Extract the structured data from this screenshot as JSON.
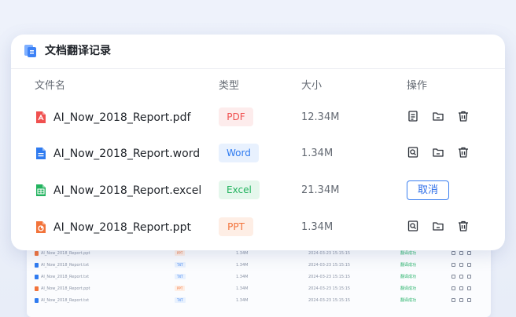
{
  "header": {
    "title": "文档翻译记录",
    "icon": "document-translate-icon"
  },
  "columns": {
    "name": "文件名",
    "type": "类型",
    "size": "大小",
    "actions": "操作"
  },
  "rows": [
    {
      "name": "AI_Now_2018_Report.pdf",
      "type": "PDF",
      "size": "12.34M",
      "icon": "pdf-icon",
      "color": "#f0504f",
      "bg": "#fdecec",
      "mode": "done-doc"
    },
    {
      "name": "AI_Now_2018_Report.word",
      "type": "Word",
      "size": "1.34M",
      "icon": "word-icon",
      "color": "#2f7bf0",
      "bg": "#e8f1fe",
      "mode": "done-preview"
    },
    {
      "name": "AI_Now_2018_Report.excel",
      "type": "Excel",
      "size": "21.34M",
      "icon": "excel-icon",
      "color": "#22b35e",
      "bg": "#e5f7ec",
      "mode": "cancel"
    },
    {
      "name": "AI_Now_2018_Report.ppt",
      "type": "PPT",
      "size": "1.34M",
      "icon": "ppt-icon",
      "color": "#f2733a",
      "bg": "#feeee5",
      "mode": "done-preview"
    }
  ],
  "cancel_label": "取消",
  "background_rows": [
    {
      "name": "AI_Now_2018_Report.ppt",
      "type": "PPT",
      "size": "1.34M",
      "time": "2024-03-23 15:15:15",
      "status": "翻译成功",
      "color": "#f2733a"
    },
    {
      "name": "AI_Now_2018_Report.txt",
      "type": "TXT",
      "size": "1.34M",
      "time": "2024-03-23 15:15:15",
      "status": "翻译成功",
      "color": "#2f7bf0"
    },
    {
      "name": "AI_Now_2018_Report.txt",
      "type": "TXT",
      "size": "1.34M",
      "time": "2024-03-23 15:15:15",
      "status": "翻译成功",
      "color": "#2f7bf0"
    },
    {
      "name": "AI_Now_2018_Report.ppt",
      "type": "PPT",
      "size": "1.34M",
      "time": "2024-03-23 15:15:15",
      "status": "翻译成功",
      "color": "#f2733a"
    },
    {
      "name": "AI_Now_2018_Report.txt",
      "type": "TXT",
      "size": "1.34M",
      "time": "2024-03-23 15:15:15",
      "status": "翻译成功",
      "color": "#2f7bf0"
    }
  ]
}
